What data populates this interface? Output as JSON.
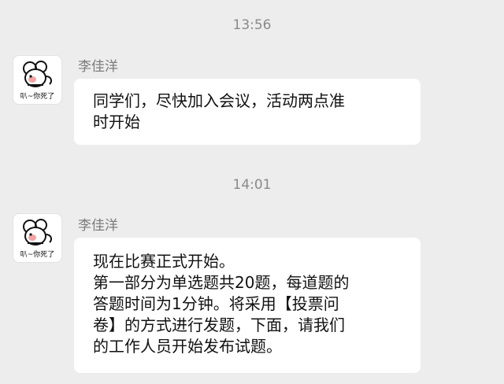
{
  "chat": {
    "groups": [
      {
        "timestamp": "13:56",
        "sender_name": "李佳洋",
        "avatar_caption": "叭~你死了",
        "message_lines": [
          "同学们，尽快加入会议，活动两点准",
          "时开始"
        ]
      },
      {
        "timestamp": "14:01",
        "sender_name": "李佳洋",
        "avatar_caption": "叭~你死了",
        "message_lines": [
          "现在比赛正式开始。",
          "第一部分为单选题共20题，每道题的",
          "答题时间为1分钟。将采用【投票问",
          "卷】的方式进行发题，下面，请我们",
          "的工作人员开始发布试题。"
        ]
      }
    ]
  }
}
